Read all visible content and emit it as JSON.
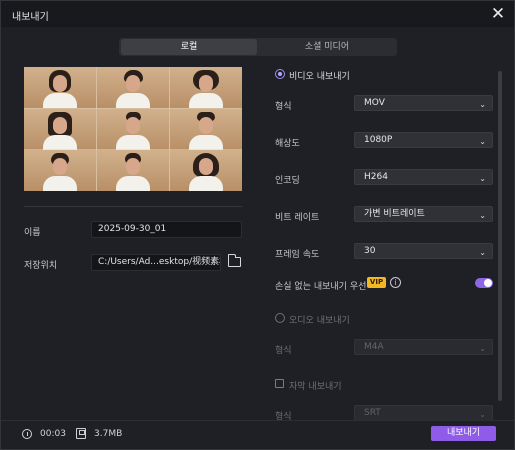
{
  "window": {
    "title": "내보내기",
    "close_icon": "close-icon"
  },
  "tabs": [
    {
      "label": "로컬"
    },
    {
      "label": "소셜 미디어"
    }
  ],
  "left": {
    "name_label": "이름",
    "name_value": "2025-09-30_01",
    "save_label": "저장위치",
    "save_value": "C:/Users/Ad...esktop/视频素材"
  },
  "video": {
    "title": "비디오 내보내기",
    "fields": [
      {
        "label": "형식",
        "value": "MOV"
      },
      {
        "label": "해상도",
        "value": "1080P"
      },
      {
        "label": "인코딩",
        "value": "H264"
      },
      {
        "label": "비트 레이트",
        "value": "가변 비트레이트"
      },
      {
        "label": "프레임 속도",
        "value": "30"
      }
    ],
    "lossless_label": "손실 없는 내보내기 우선",
    "vip_label": "VIP",
    "toggle_state": "on"
  },
  "audio": {
    "title": "오디오 내보내기",
    "format_label": "형식",
    "format_value": "M4A"
  },
  "subtitle": {
    "title": "자막 내보내기",
    "format_label": "형식",
    "format_value": "SRT"
  },
  "footer": {
    "duration": "00:03",
    "size": "3.7MB",
    "export_label": "내보내기"
  },
  "colors": {
    "accent": "#8f5ce8",
    "vip": "#f2b722",
    "background": "#1f2025"
  }
}
